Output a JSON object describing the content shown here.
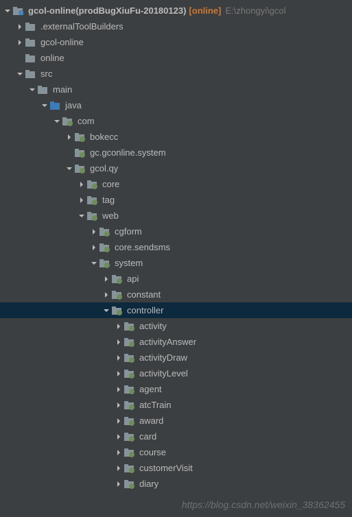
{
  "watermark": "https://blog.csdn.net/weixin_38362455",
  "icons": {
    "module": "module-icon",
    "folder": "folder-icon",
    "folder_open": "folder-open-icon",
    "source_folder": "source-folder-icon",
    "package": "package-icon"
  },
  "tree": [
    {
      "depth": 0,
      "expand": "down",
      "icon": "module",
      "label": "gcol-online(prodBugXiuFu-20180123)",
      "bold": true,
      "status": "[online]",
      "path": "E:\\zhongyi\\gcol"
    },
    {
      "depth": 1,
      "expand": "right",
      "icon": "folder",
      "label": ".externalToolBuilders"
    },
    {
      "depth": 1,
      "expand": "right",
      "icon": "folder",
      "label": "gcol-online"
    },
    {
      "depth": 1,
      "expand": "none",
      "icon": "folder",
      "label": "online"
    },
    {
      "depth": 1,
      "expand": "down",
      "icon": "folder",
      "label": "src"
    },
    {
      "depth": 2,
      "expand": "down",
      "icon": "folder",
      "label": "main"
    },
    {
      "depth": 3,
      "expand": "down",
      "icon": "source_folder",
      "label": "java"
    },
    {
      "depth": 4,
      "expand": "down",
      "icon": "package",
      "label": "com"
    },
    {
      "depth": 5,
      "expand": "right",
      "icon": "package",
      "label": "bokecc"
    },
    {
      "depth": 5,
      "expand": "none",
      "icon": "package",
      "label": "gc.gconline.system"
    },
    {
      "depth": 5,
      "expand": "down",
      "icon": "package",
      "label": "gcol.qy"
    },
    {
      "depth": 6,
      "expand": "right",
      "icon": "package",
      "label": "core"
    },
    {
      "depth": 6,
      "expand": "right",
      "icon": "package",
      "label": "tag"
    },
    {
      "depth": 6,
      "expand": "down",
      "icon": "package",
      "label": "web"
    },
    {
      "depth": 7,
      "expand": "right",
      "icon": "package",
      "label": "cgform"
    },
    {
      "depth": 7,
      "expand": "right",
      "icon": "package",
      "label": "core.sendsms"
    },
    {
      "depth": 7,
      "expand": "down",
      "icon": "package",
      "label": "system"
    },
    {
      "depth": 8,
      "expand": "right",
      "icon": "package",
      "label": "api"
    },
    {
      "depth": 8,
      "expand": "right",
      "icon": "package",
      "label": "constant"
    },
    {
      "depth": 8,
      "expand": "down",
      "icon": "package",
      "label": "controller",
      "selected": true
    },
    {
      "depth": 9,
      "expand": "right",
      "icon": "package",
      "label": "activity"
    },
    {
      "depth": 9,
      "expand": "right",
      "icon": "package",
      "label": "activityAnswer"
    },
    {
      "depth": 9,
      "expand": "right",
      "icon": "package",
      "label": "activityDraw"
    },
    {
      "depth": 9,
      "expand": "right",
      "icon": "package",
      "label": "activityLevel"
    },
    {
      "depth": 9,
      "expand": "right",
      "icon": "package",
      "label": "agent"
    },
    {
      "depth": 9,
      "expand": "right",
      "icon": "package",
      "label": "atcTrain"
    },
    {
      "depth": 9,
      "expand": "right",
      "icon": "package",
      "label": "award"
    },
    {
      "depth": 9,
      "expand": "right",
      "icon": "package",
      "label": "card"
    },
    {
      "depth": 9,
      "expand": "right",
      "icon": "package",
      "label": "course"
    },
    {
      "depth": 9,
      "expand": "right",
      "icon": "package",
      "label": "customerVisit"
    },
    {
      "depth": 9,
      "expand": "right",
      "icon": "package",
      "label": "diary"
    }
  ]
}
